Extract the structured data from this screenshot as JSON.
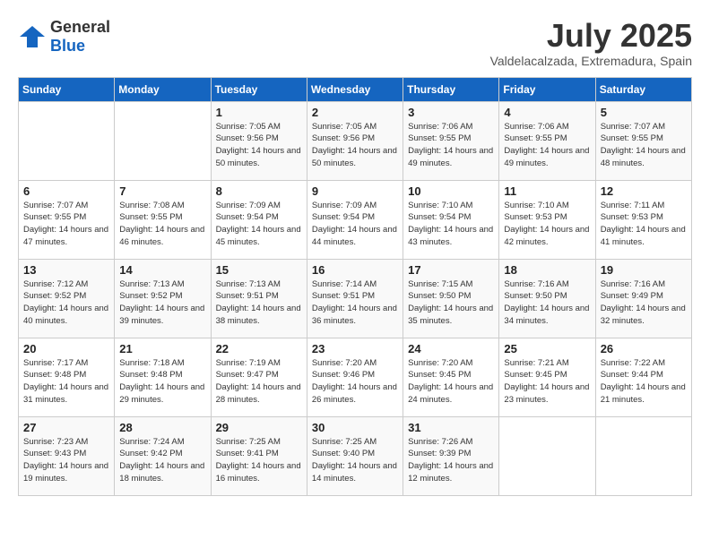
{
  "header": {
    "logo": {
      "text_general": "General",
      "text_blue": "Blue"
    },
    "title": "July 2025",
    "location": "Valdelacalzada, Extremadura, Spain"
  },
  "calendar": {
    "days_of_week": [
      "Sunday",
      "Monday",
      "Tuesday",
      "Wednesday",
      "Thursday",
      "Friday",
      "Saturday"
    ],
    "weeks": [
      [
        {
          "day": "",
          "info": ""
        },
        {
          "day": "",
          "info": ""
        },
        {
          "day": "1",
          "info": "Sunrise: 7:05 AM\nSunset: 9:56 PM\nDaylight: 14 hours\nand 50 minutes."
        },
        {
          "day": "2",
          "info": "Sunrise: 7:05 AM\nSunset: 9:56 PM\nDaylight: 14 hours\nand 50 minutes."
        },
        {
          "day": "3",
          "info": "Sunrise: 7:06 AM\nSunset: 9:55 PM\nDaylight: 14 hours\nand 49 minutes."
        },
        {
          "day": "4",
          "info": "Sunrise: 7:06 AM\nSunset: 9:55 PM\nDaylight: 14 hours\nand 49 minutes."
        },
        {
          "day": "5",
          "info": "Sunrise: 7:07 AM\nSunset: 9:55 PM\nDaylight: 14 hours\nand 48 minutes."
        }
      ],
      [
        {
          "day": "6",
          "info": "Sunrise: 7:07 AM\nSunset: 9:55 PM\nDaylight: 14 hours\nand 47 minutes."
        },
        {
          "day": "7",
          "info": "Sunrise: 7:08 AM\nSunset: 9:55 PM\nDaylight: 14 hours\nand 46 minutes."
        },
        {
          "day": "8",
          "info": "Sunrise: 7:09 AM\nSunset: 9:54 PM\nDaylight: 14 hours\nand 45 minutes."
        },
        {
          "day": "9",
          "info": "Sunrise: 7:09 AM\nSunset: 9:54 PM\nDaylight: 14 hours\nand 44 minutes."
        },
        {
          "day": "10",
          "info": "Sunrise: 7:10 AM\nSunset: 9:54 PM\nDaylight: 14 hours\nand 43 minutes."
        },
        {
          "day": "11",
          "info": "Sunrise: 7:10 AM\nSunset: 9:53 PM\nDaylight: 14 hours\nand 42 minutes."
        },
        {
          "day": "12",
          "info": "Sunrise: 7:11 AM\nSunset: 9:53 PM\nDaylight: 14 hours\nand 41 minutes."
        }
      ],
      [
        {
          "day": "13",
          "info": "Sunrise: 7:12 AM\nSunset: 9:52 PM\nDaylight: 14 hours\nand 40 minutes."
        },
        {
          "day": "14",
          "info": "Sunrise: 7:13 AM\nSunset: 9:52 PM\nDaylight: 14 hours\nand 39 minutes."
        },
        {
          "day": "15",
          "info": "Sunrise: 7:13 AM\nSunset: 9:51 PM\nDaylight: 14 hours\nand 38 minutes."
        },
        {
          "day": "16",
          "info": "Sunrise: 7:14 AM\nSunset: 9:51 PM\nDaylight: 14 hours\nand 36 minutes."
        },
        {
          "day": "17",
          "info": "Sunrise: 7:15 AM\nSunset: 9:50 PM\nDaylight: 14 hours\nand 35 minutes."
        },
        {
          "day": "18",
          "info": "Sunrise: 7:16 AM\nSunset: 9:50 PM\nDaylight: 14 hours\nand 34 minutes."
        },
        {
          "day": "19",
          "info": "Sunrise: 7:16 AM\nSunset: 9:49 PM\nDaylight: 14 hours\nand 32 minutes."
        }
      ],
      [
        {
          "day": "20",
          "info": "Sunrise: 7:17 AM\nSunset: 9:48 PM\nDaylight: 14 hours\nand 31 minutes."
        },
        {
          "day": "21",
          "info": "Sunrise: 7:18 AM\nSunset: 9:48 PM\nDaylight: 14 hours\nand 29 minutes."
        },
        {
          "day": "22",
          "info": "Sunrise: 7:19 AM\nSunset: 9:47 PM\nDaylight: 14 hours\nand 28 minutes."
        },
        {
          "day": "23",
          "info": "Sunrise: 7:20 AM\nSunset: 9:46 PM\nDaylight: 14 hours\nand 26 minutes."
        },
        {
          "day": "24",
          "info": "Sunrise: 7:20 AM\nSunset: 9:45 PM\nDaylight: 14 hours\nand 24 minutes."
        },
        {
          "day": "25",
          "info": "Sunrise: 7:21 AM\nSunset: 9:45 PM\nDaylight: 14 hours\nand 23 minutes."
        },
        {
          "day": "26",
          "info": "Sunrise: 7:22 AM\nSunset: 9:44 PM\nDaylight: 14 hours\nand 21 minutes."
        }
      ],
      [
        {
          "day": "27",
          "info": "Sunrise: 7:23 AM\nSunset: 9:43 PM\nDaylight: 14 hours\nand 19 minutes."
        },
        {
          "day": "28",
          "info": "Sunrise: 7:24 AM\nSunset: 9:42 PM\nDaylight: 14 hours\nand 18 minutes."
        },
        {
          "day": "29",
          "info": "Sunrise: 7:25 AM\nSunset: 9:41 PM\nDaylight: 14 hours\nand 16 minutes."
        },
        {
          "day": "30",
          "info": "Sunrise: 7:25 AM\nSunset: 9:40 PM\nDaylight: 14 hours\nand 14 minutes."
        },
        {
          "day": "31",
          "info": "Sunrise: 7:26 AM\nSunset: 9:39 PM\nDaylight: 14 hours\nand 12 minutes."
        },
        {
          "day": "",
          "info": ""
        },
        {
          "day": "",
          "info": ""
        }
      ]
    ]
  }
}
